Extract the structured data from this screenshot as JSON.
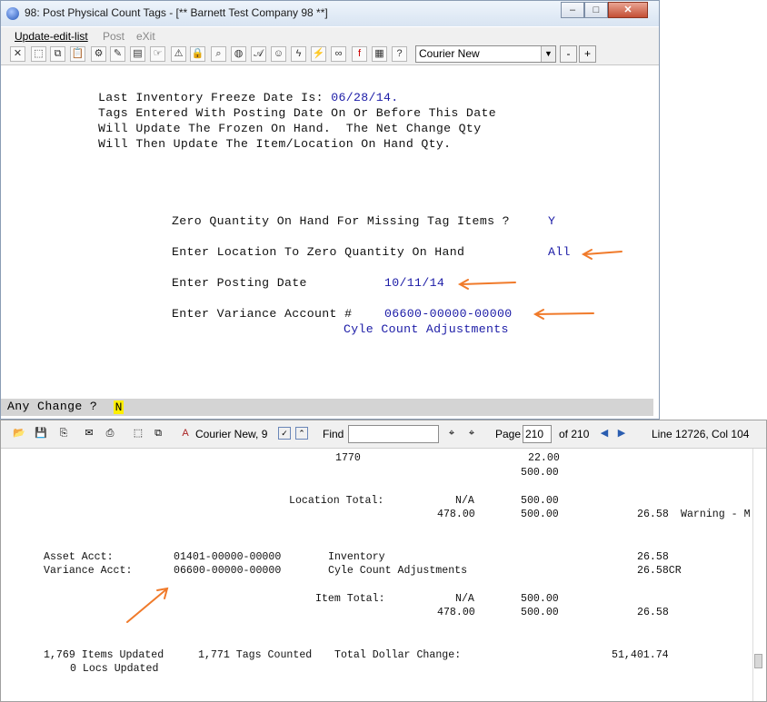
{
  "window": {
    "title": "98: Post Physical Count Tags - [** Barnett Test Company 98 **]",
    "minimize": "–",
    "maximize": "□",
    "close": "✕"
  },
  "menu": {
    "update": "Update-edit-list",
    "post": "Post",
    "exit": "eXit"
  },
  "toolbar": {
    "font": "Courier New",
    "dropdown": "▼",
    "decrease": "-",
    "increase": "+"
  },
  "terminal": {
    "freeze_prefix": "Last Inventory Freeze Date Is: ",
    "freeze_date": "06/28/14.",
    "line2": "Tags Entered With Posting Date On Or Before This Date",
    "line3": "Will Update The Frozen On Hand.  The Net Change Qty",
    "line4": "Will Then Update The Item/Location On Hand Qty.",
    "zero_qty_label": "Zero Quantity On Hand For Missing Tag Items ?",
    "zero_qty_value": "Y",
    "location_label": "Enter Location To Zero Quantity On Hand",
    "location_value": "All",
    "posting_label": "Enter Posting Date",
    "posting_value": "10/11/14",
    "variance_label": "Enter Variance Account #",
    "variance_value": "06600-00000-00000",
    "variance_desc": "Cyle Count Adjustments",
    "prompt": "Any Change ?",
    "cursor": "N"
  },
  "report_toolbar": {
    "font": "Courier New, 9",
    "find_label": "Find",
    "find_value": "",
    "page_label": "Page",
    "page_value": "210",
    "of_pages": "of 210",
    "position": "Line 12726, Col 104"
  },
  "report": {
    "r1_num": "1770",
    "r1_val": "22.00",
    "r2_val": "500.00",
    "loc_total_label": "Location Total:",
    "loc_na": "N/A",
    "loc_val": "500.00",
    "r4_a": "478.00",
    "r4_b": "500.00",
    "r4_c": "26.58",
    "r4_warn": "Warning - M",
    "asset_label": "Asset Acct:",
    "asset_acct": "01401-00000-00000",
    "asset_desc": "Inventory",
    "asset_amt": "26.58",
    "var_label": "Variance Acct:",
    "var_acct": "06600-00000-00000",
    "var_desc": "Cyle Count Adjustments",
    "var_amt": "26.58CR",
    "item_total_label": "Item Total:",
    "item_na": "N/A",
    "item_val": "500.00",
    "r9_a": "478.00",
    "r9_b": "500.00",
    "r9_c": "26.58",
    "items_updated": "1,769 Items Updated",
    "tags_counted": "1,771 Tags Counted",
    "total_dollar_label": "Total Dollar Change:",
    "total_dollar_value": "51,401.74",
    "locs_updated": "0 Locs Updated"
  },
  "colors": {
    "accent_blue": "#1a1aa6",
    "annotation_arrow": "#f07a2a",
    "cursor_highlight": "#ffef00"
  }
}
